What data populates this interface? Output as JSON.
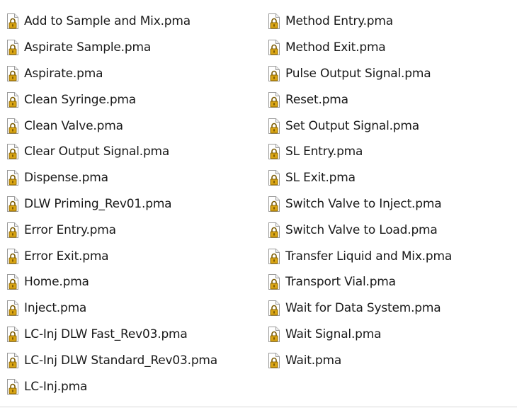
{
  "files": {
    "left": [
      "Add to Sample and Mix.pma",
      "Aspirate Sample.pma",
      "Aspirate.pma",
      "Clean Syringe.pma",
      "Clean Valve.pma",
      "Clear Output Signal.pma",
      "Dispense.pma",
      "DLW Priming_Rev01.pma",
      "Error Entry.pma",
      "Error Exit.pma",
      "Home.pma",
      "Inject.pma",
      "LC-Inj DLW Fast_Rev03.pma",
      "LC-Inj DLW Standard_Rev03.pma",
      "LC-Inj.pma"
    ],
    "right": [
      "Method Entry.pma",
      "Method Exit.pma",
      "Pulse Output Signal.pma",
      "Reset.pma",
      "Set Output Signal.pma",
      "SL Entry.pma",
      "SL Exit.pma",
      "Switch Valve to Inject.pma",
      "Switch Valve to Load.pma",
      "Transfer Liquid and Mix.pma",
      "Transport Vial.pma",
      "Wait for Data System.pma",
      "Wait Signal.pma",
      "Wait.pma"
    ]
  },
  "icon": {
    "name": "locked-file-icon",
    "lock_color": "#d9a514",
    "page_border": "#9a9a9a"
  }
}
